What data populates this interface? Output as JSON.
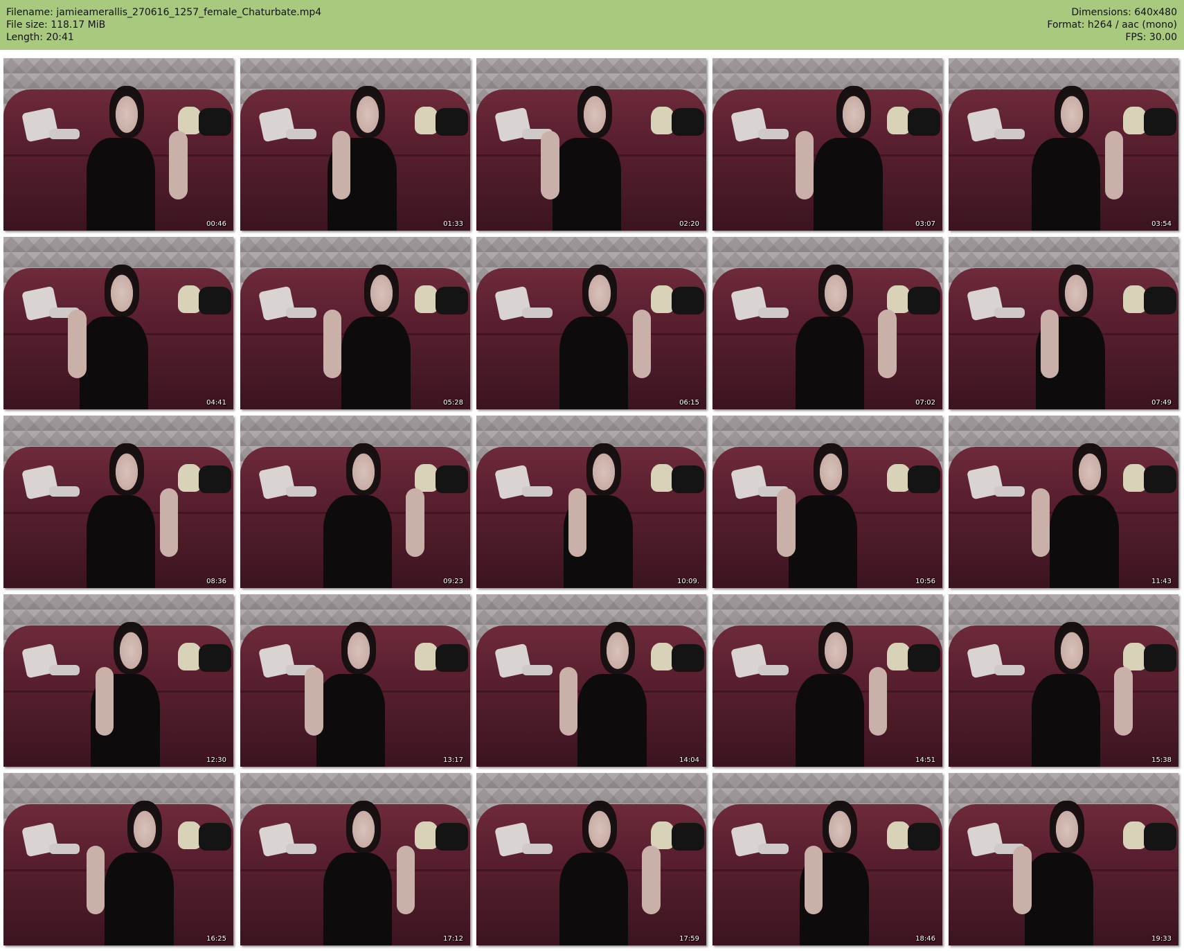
{
  "header": {
    "filename_label": "Filename:",
    "filename": "jamieamerallis_270616_1257_female_Chaturbate.mp4",
    "filesize_label": "File size:",
    "filesize": "118.17 MiB",
    "length_label": "Length:",
    "length": "20:41",
    "dimensions_label": "Dimensions:",
    "dimensions": "640x480",
    "format_label": "Format:",
    "format": "h264 / aac (mono)",
    "fps_label": "FPS:",
    "fps": "30.00"
  },
  "colors": {
    "header_background": "#a9c97f",
    "page_background": "#ffffff"
  },
  "thumbnails": [
    {
      "time": "00:46"
    },
    {
      "time": "01:33"
    },
    {
      "time": "02:20"
    },
    {
      "time": "03:07"
    },
    {
      "time": "03:54"
    },
    {
      "time": "04:41"
    },
    {
      "time": "05:28"
    },
    {
      "time": "06:15"
    },
    {
      "time": "07:02"
    },
    {
      "time": "07:49"
    },
    {
      "time": "08:36"
    },
    {
      "time": "09:23"
    },
    {
      "time": "10:09."
    },
    {
      "time": "10:56"
    },
    {
      "time": "11:43"
    },
    {
      "time": "12:30"
    },
    {
      "time": "13:17"
    },
    {
      "time": "14:04"
    },
    {
      "time": "14:51"
    },
    {
      "time": "15:38"
    },
    {
      "time": "16:25"
    },
    {
      "time": "17:12"
    },
    {
      "time": "17:59"
    },
    {
      "time": "18:46"
    },
    {
      "time": "19:33"
    }
  ]
}
